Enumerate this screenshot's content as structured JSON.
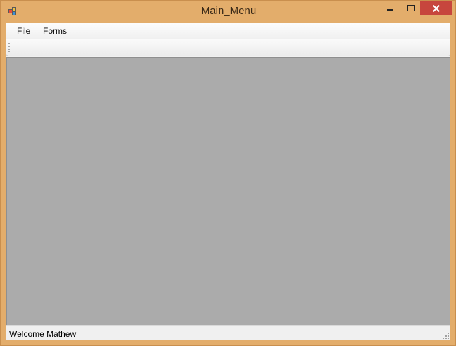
{
  "window": {
    "title": "Main_Menu",
    "controls": {
      "minimize_icon": "minimize-icon",
      "maximize_icon": "maximize-icon",
      "close_icon": "close-icon",
      "close_color": "#c7463d"
    },
    "frame_color": "#e3ad6b"
  },
  "menubar": {
    "items": [
      {
        "label": "File"
      },
      {
        "label": "Forms"
      }
    ]
  },
  "mdi_area": {
    "background_color": "#ababab"
  },
  "statusbar": {
    "text": "Welcome Mathew"
  }
}
